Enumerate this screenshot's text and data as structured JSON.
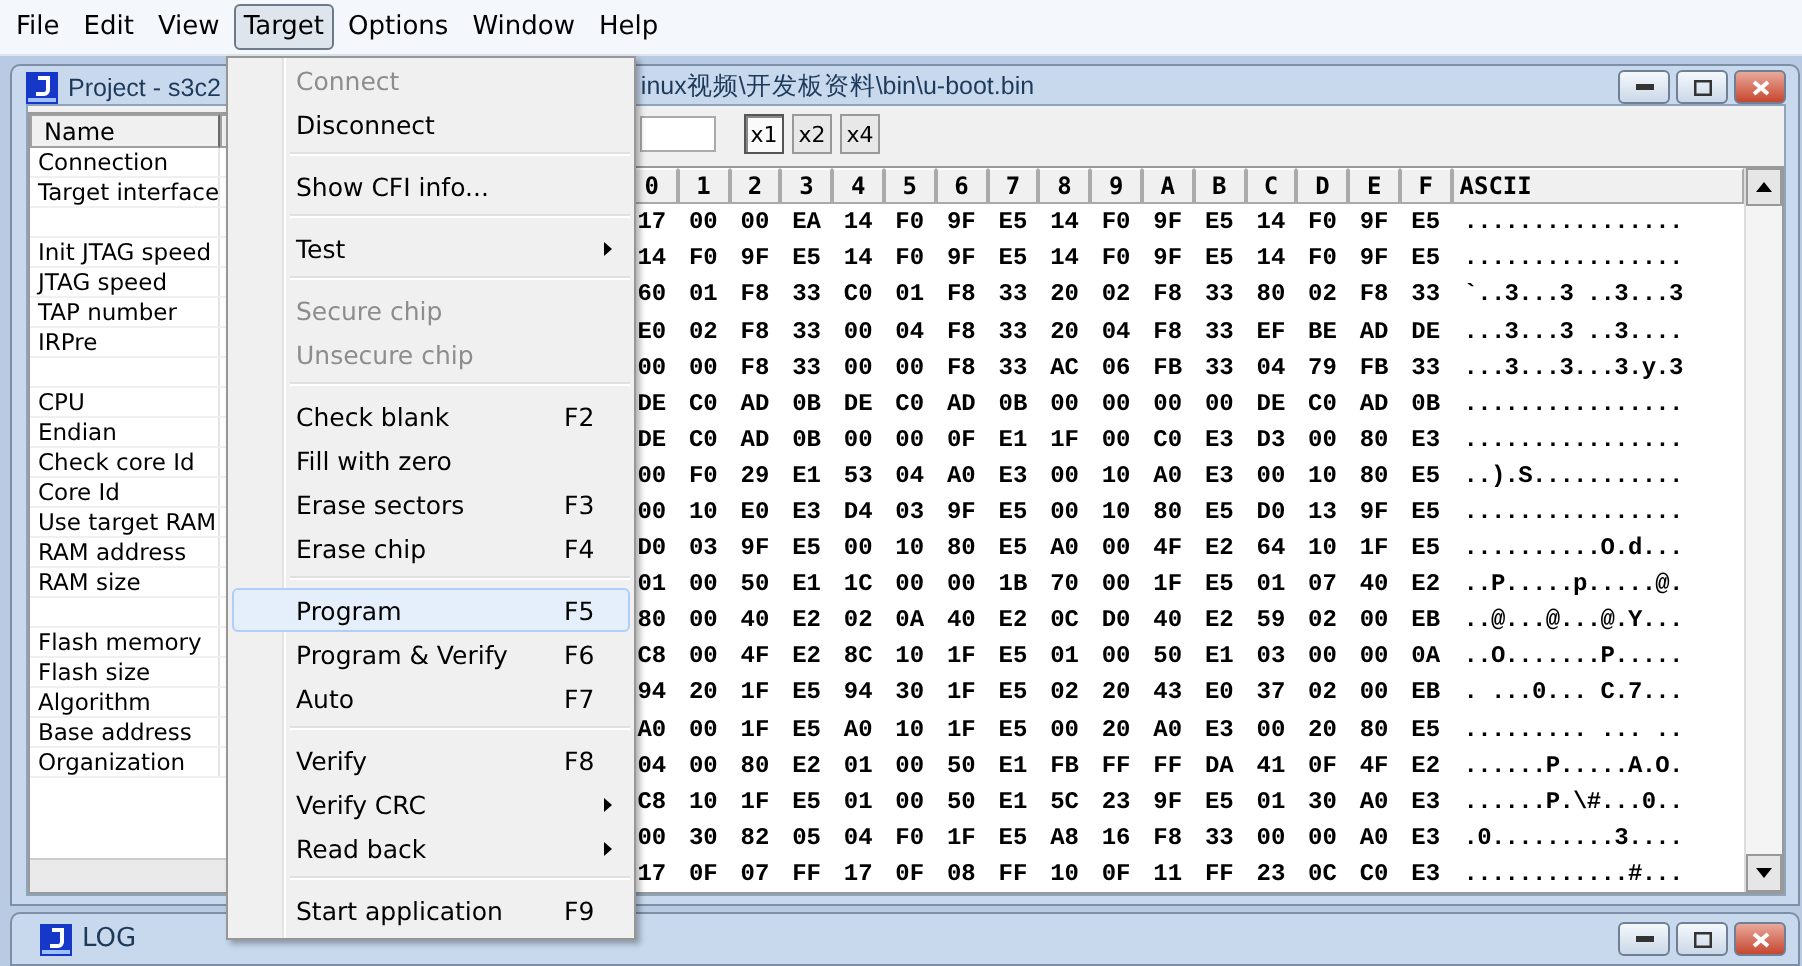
{
  "menu_bar": [
    {
      "label": "File",
      "selected": false
    },
    {
      "label": "Edit",
      "selected": false
    },
    {
      "label": "View",
      "selected": false
    },
    {
      "label": "Target",
      "selected": true
    },
    {
      "label": "Options",
      "selected": false
    },
    {
      "label": "Window",
      "selected": false
    },
    {
      "label": "Help",
      "selected": false
    }
  ],
  "project_window": {
    "title_start": "Project - s3c2",
    "title_end": "inux视频\\开发板资料\\bin\\u-boot.bin"
  },
  "properties": {
    "name_header": "Name",
    "sections": [
      [
        "Connection",
        "Target interface"
      ],
      [
        "Init JTAG speed",
        "JTAG speed",
        "TAP number",
        "IRPre"
      ],
      [
        "CPU",
        "Endian",
        "Check core Id",
        "Core Id",
        "Use target RAM",
        "RAM address",
        "RAM size"
      ],
      [
        "Flash memory",
        "Flash size",
        "Algorithm",
        "Base address",
        "Organization"
      ]
    ]
  },
  "hex_view": {
    "zoom_buttons": [
      {
        "label": "x1",
        "selected": true
      },
      {
        "label": "x2",
        "selected": false
      },
      {
        "label": "x4",
        "selected": false
      }
    ],
    "columns": [
      "0",
      "1",
      "2",
      "3",
      "4",
      "5",
      "6",
      "7",
      "8",
      "9",
      "A",
      "B",
      "C",
      "D",
      "E",
      "F"
    ],
    "ascii_header": "ASCII",
    "rows": [
      {
        "bytes": "17 00 00 EA 14 F0 9F E5 14 F0 9F E5 14 F0 9F E5",
        "ascii": "................"
      },
      {
        "bytes": "14 F0 9F E5 14 F0 9F E5 14 F0 9F E5 14 F0 9F E5",
        "ascii": "................"
      },
      {
        "bytes": "60 01 F8 33 C0 01 F8 33 20 02 F8 33 80 02 F8 33",
        "ascii": "`..3...3 ..3...3"
      },
      {
        "bytes": "E0 02 F8 33 00 04 F8 33 20 04 F8 33 EF BE AD DE",
        "ascii": "...3...3 ..3...."
      },
      {
        "bytes": "00 00 F8 33 00 00 F8 33 AC 06 FB 33 04 79 FB 33",
        "ascii": "...3...3...3.y.3"
      },
      {
        "bytes": "DE C0 AD 0B DE C0 AD 0B 00 00 00 00 DE C0 AD 0B",
        "ascii": "................"
      },
      {
        "bytes": "DE C0 AD 0B 00 00 0F E1 1F 00 C0 E3 D3 00 80 E3",
        "ascii": "................"
      },
      {
        "bytes": "00 F0 29 E1 53 04 A0 E3 00 10 A0 E3 00 10 80 E5",
        "ascii": "..).S..........."
      },
      {
        "bytes": "00 10 E0 E3 D4 03 9F E5 00 10 80 E5 D0 13 9F E5",
        "ascii": "................"
      },
      {
        "bytes": "D0 03 9F E5 00 10 80 E5 A0 00 4F E2 64 10 1F E5",
        "ascii": "..........O.d..."
      },
      {
        "bytes": "01 00 50 E1 1C 00 00 1B 70 00 1F E5 01 07 40 E2",
        "ascii": "..P.....p.....@."
      },
      {
        "bytes": "80 00 40 E2 02 0A 40 E2 0C D0 40 E2 59 02 00 EB",
        "ascii": "..@...@...@.Y..."
      },
      {
        "bytes": "C8 00 4F E2 8C 10 1F E5 01 00 50 E1 03 00 00 0A",
        "ascii": "..O.......P....."
      },
      {
        "bytes": "94 20 1F E5 94 30 1F E5 02 20 43 E0 37 02 00 EB",
        "ascii": ". ...0... C.7..."
      },
      {
        "bytes": "A0 00 1F E5 A0 10 1F E5 00 20 A0 E3 00 20 80 E5",
        "ascii": "......... ... .."
      },
      {
        "bytes": "04 00 80 E2 01 00 50 E1 FB FF FF DA 41 0F 4F E2",
        "ascii": "......P.....A.O."
      },
      {
        "bytes": "C8 10 1F E5 01 00 50 E1 5C 23 9F E5 01 30 A0 E3",
        "ascii": "......P.\\#...0.."
      },
      {
        "bytes": "00 30 82 05 04 F0 1F E5 A8 16 F8 33 00 00 A0 E3",
        "ascii": ".0.........3...."
      },
      {
        "bytes": "17 0F 07 FF 17 0F 08 FF 10 0F 11 FF 23 0C C0 E3",
        "ascii": "............#..."
      }
    ]
  },
  "target_menu": [
    {
      "kind": "item",
      "label": "Connect",
      "disabled": true,
      "submenu": false,
      "selected": false
    },
    {
      "kind": "item",
      "label": "Disconnect",
      "disabled": false,
      "submenu": false,
      "selected": false
    },
    {
      "kind": "separator"
    },
    {
      "kind": "item",
      "label": "Show CFI info...",
      "disabled": false,
      "submenu": false,
      "selected": false
    },
    {
      "kind": "separator"
    },
    {
      "kind": "item",
      "label": "Test",
      "disabled": false,
      "submenu": true,
      "selected": false
    },
    {
      "kind": "separator"
    },
    {
      "kind": "item",
      "label": "Secure chip",
      "disabled": true,
      "submenu": false,
      "selected": false
    },
    {
      "kind": "item",
      "label": "Unsecure chip",
      "disabled": true,
      "submenu": false,
      "selected": false
    },
    {
      "kind": "separator"
    },
    {
      "kind": "item",
      "label": "Check blank",
      "shortcut": "F2",
      "disabled": false,
      "submenu": false,
      "selected": false
    },
    {
      "kind": "item",
      "label": "Fill with zero",
      "disabled": false,
      "submenu": false,
      "selected": false
    },
    {
      "kind": "item",
      "label": "Erase sectors",
      "shortcut": "F3",
      "disabled": false,
      "submenu": false,
      "selected": false
    },
    {
      "kind": "item",
      "label": "Erase chip",
      "shortcut": "F4",
      "disabled": false,
      "submenu": false,
      "selected": false
    },
    {
      "kind": "separator"
    },
    {
      "kind": "item",
      "label": "Program",
      "shortcut": "F5",
      "disabled": false,
      "submenu": false,
      "selected": true
    },
    {
      "kind": "item",
      "label": "Program & Verify",
      "shortcut": "F6",
      "disabled": false,
      "submenu": false,
      "selected": false
    },
    {
      "kind": "item",
      "label": "Auto",
      "shortcut": "F7",
      "disabled": false,
      "submenu": false,
      "selected": false
    },
    {
      "kind": "separator"
    },
    {
      "kind": "item",
      "label": "Verify",
      "shortcut": "F8",
      "disabled": false,
      "submenu": false,
      "selected": false
    },
    {
      "kind": "item",
      "label": "Verify CRC",
      "disabled": false,
      "submenu": true,
      "selected": false
    },
    {
      "kind": "item",
      "label": "Read back",
      "disabled": false,
      "submenu": true,
      "selected": false
    },
    {
      "kind": "separator"
    },
    {
      "kind": "item",
      "label": "Start application",
      "shortcut": "F9",
      "disabled": false,
      "submenu": false,
      "selected": false
    }
  ],
  "log_window": {
    "title": "LOG"
  }
}
